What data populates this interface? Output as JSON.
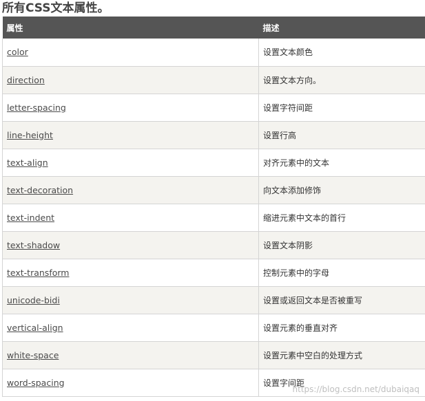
{
  "heading": "所有CSS文本属性。",
  "table": {
    "headers": [
      "属性",
      "描述"
    ],
    "rows": [
      {
        "property": "color",
        "description": "设置文本颜色"
      },
      {
        "property": "direction",
        "description": "设置文本方向。"
      },
      {
        "property": "letter-spacing",
        "description": "设置字符间距"
      },
      {
        "property": "line-height",
        "description": "设置行高"
      },
      {
        "property": "text-align",
        "description": "对齐元素中的文本"
      },
      {
        "property": "text-decoration",
        "description": "向文本添加修饰"
      },
      {
        "property": "text-indent",
        "description": "缩进元素中文本的首行"
      },
      {
        "property": "text-shadow",
        "description": "设置文本阴影"
      },
      {
        "property": "text-transform",
        "description": "控制元素中的字母"
      },
      {
        "property": "unicode-bidi",
        "description": "设置或返回文本是否被重写"
      },
      {
        "property": "vertical-align",
        "description": "设置元素的垂直对齐"
      },
      {
        "property": "white-space",
        "description": "设置元素中空白的处理方式"
      },
      {
        "property": "word-spacing",
        "description": "设置字间距"
      }
    ]
  },
  "watermark": "https://blog.csdn.net/dubaiqaq",
  "colors": {
    "header_bg": "#555555",
    "alt_row_bg": "#f4f3ef",
    "border": "#d4d4d4"
  }
}
